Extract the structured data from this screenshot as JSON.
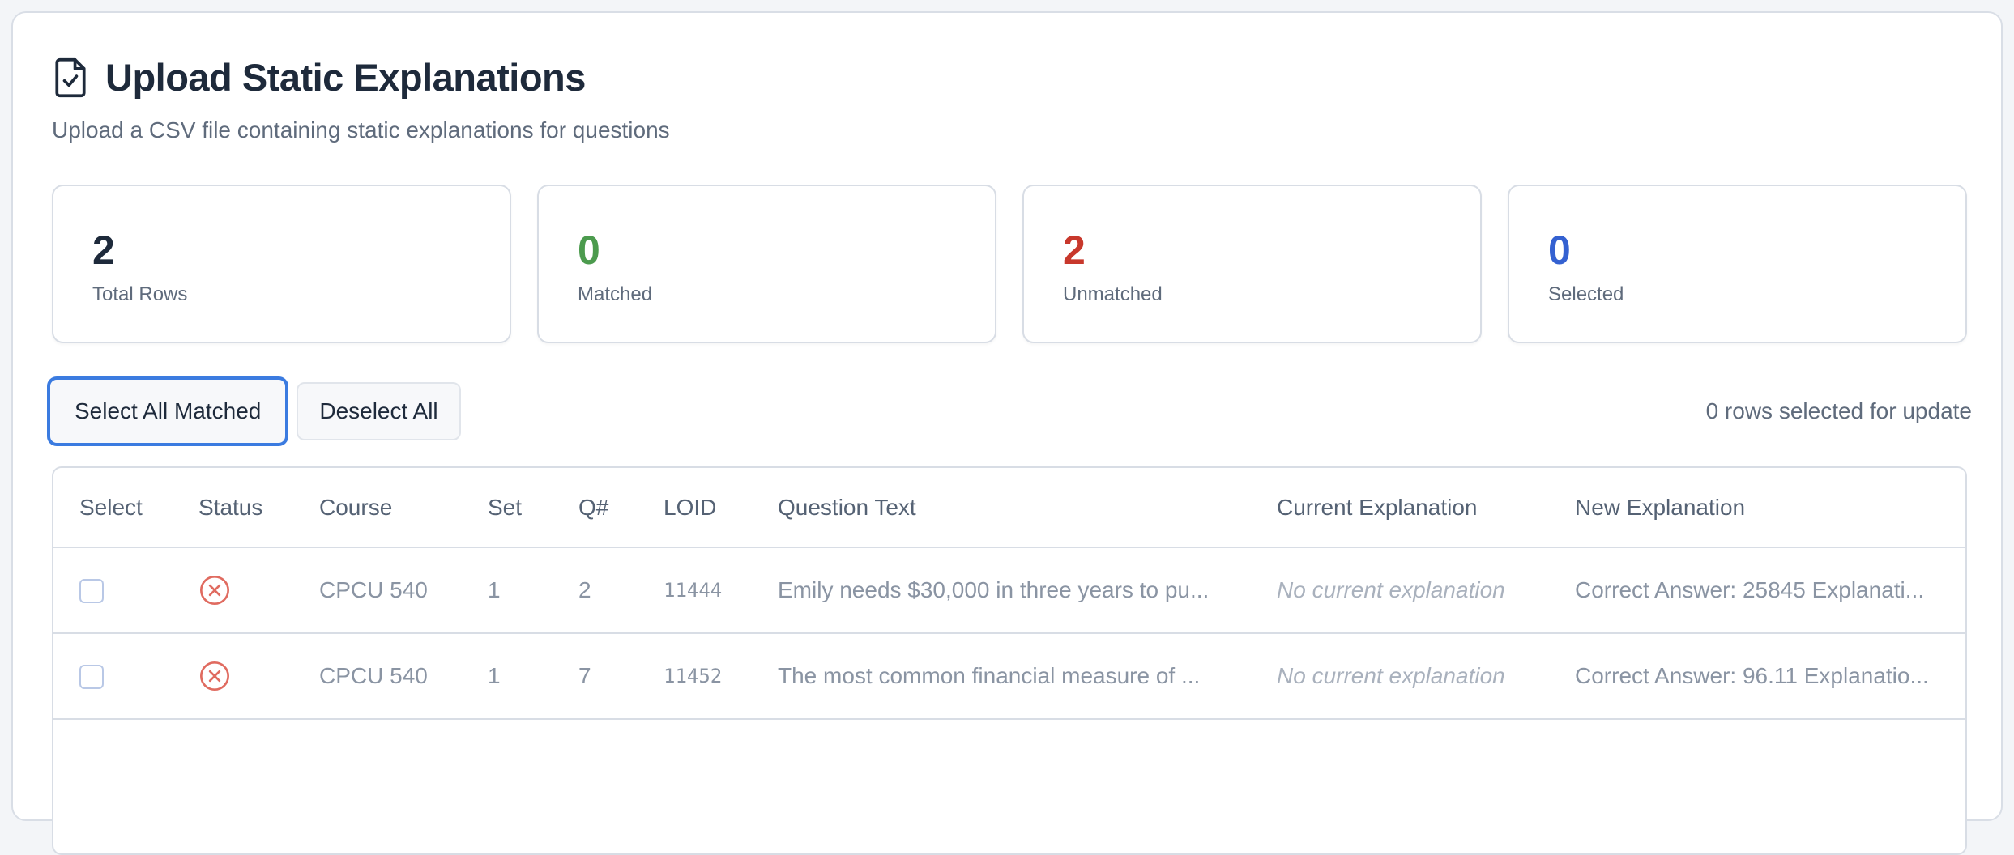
{
  "header": {
    "title": "Upload Static Explanations",
    "subtitle": "Upload a CSV file containing static explanations for questions",
    "icon": "file-check-icon"
  },
  "stats": [
    {
      "value": "2",
      "label": "Total Rows",
      "color": "#1e2a3b"
    },
    {
      "value": "0",
      "label": "Matched",
      "color": "#4c9b4e"
    },
    {
      "value": "2",
      "label": "Unmatched",
      "color": "#c8382c"
    },
    {
      "value": "0",
      "label": "Selected",
      "color": "#3461d1"
    }
  ],
  "toolbar": {
    "select_all_label": "Select All Matched",
    "deselect_all_label": "Deselect All",
    "status": "0 rows selected for update"
  },
  "table": {
    "columns": [
      "Select",
      "Status",
      "Course",
      "Set",
      "Q#",
      "LOID",
      "Question Text",
      "Current Explanation",
      "New Explanation"
    ],
    "rows": [
      {
        "status": "unmatched",
        "status_icon": "x-circle-icon",
        "course": "CPCU 540",
        "set": "1",
        "q": "2",
        "loid": "11444",
        "question": "Emily needs $30,000 in three years to pu...",
        "current": "No current explanation",
        "new": "Correct Answer: 25845 Explanati..."
      },
      {
        "status": "unmatched",
        "status_icon": "x-circle-icon",
        "course": "CPCU 540",
        "set": "1",
        "q": "7",
        "loid": "11452",
        "question": "The most common financial measure of ...",
        "current": "No current explanation",
        "new": "Correct Answer: 96.11 Explanatio..."
      }
    ]
  },
  "colors": {
    "accent": "#3b7be0",
    "error": "#e06b60"
  }
}
